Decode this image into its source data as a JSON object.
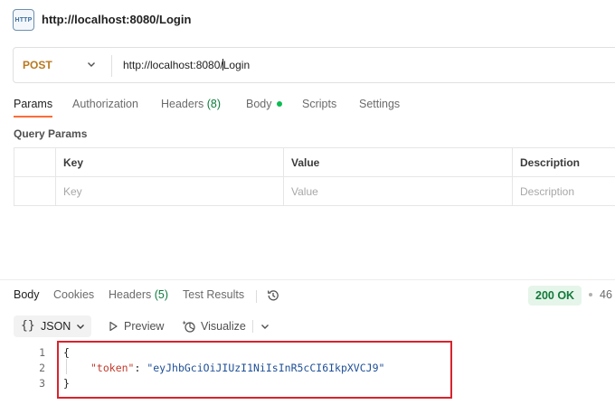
{
  "tab": {
    "badge": "HTTP",
    "title": "http://localhost:8080/Login"
  },
  "request": {
    "method": "POST",
    "url": "http://localhost:8080/Login",
    "url_before_caret": "http://localhost:8080/",
    "url_after_caret": "Login",
    "method_color": "#b7791f"
  },
  "request_tabs": [
    {
      "label": "Params",
      "active": true
    },
    {
      "label": "Authorization"
    },
    {
      "label": "Headers",
      "count": "(8)"
    },
    {
      "label": "Body",
      "has_dot": true
    },
    {
      "label": "Scripts"
    },
    {
      "label": "Settings"
    }
  ],
  "query_params": {
    "title": "Query Params",
    "columns": [
      "Key",
      "Value",
      "Description"
    ],
    "placeholders": [
      "Key",
      "Value",
      "Description"
    ]
  },
  "response_tabs": [
    {
      "label": "Body",
      "active": true
    },
    {
      "label": "Cookies"
    },
    {
      "label": "Headers",
      "count": "(5)"
    },
    {
      "label": "Test Results"
    }
  ],
  "response_status": {
    "code": "200 OK",
    "time": "46"
  },
  "format": {
    "braces": "{}",
    "selected": "JSON",
    "preview": "Preview",
    "visualize": "Visualize"
  },
  "code": {
    "lines": [
      "1",
      "2",
      "3"
    ],
    "open": "{",
    "key": "\"token\"",
    "colon": ": ",
    "value": "\"eyJhbGciOiJIUzI1NiIsInR5cCI6IkpXVCJ9\"",
    "close": "}"
  },
  "colors": {
    "accent": "#ff6c37",
    "status_bg": "#e6f5ea",
    "status_text": "#127a3b",
    "highlight": "#d9232d"
  }
}
